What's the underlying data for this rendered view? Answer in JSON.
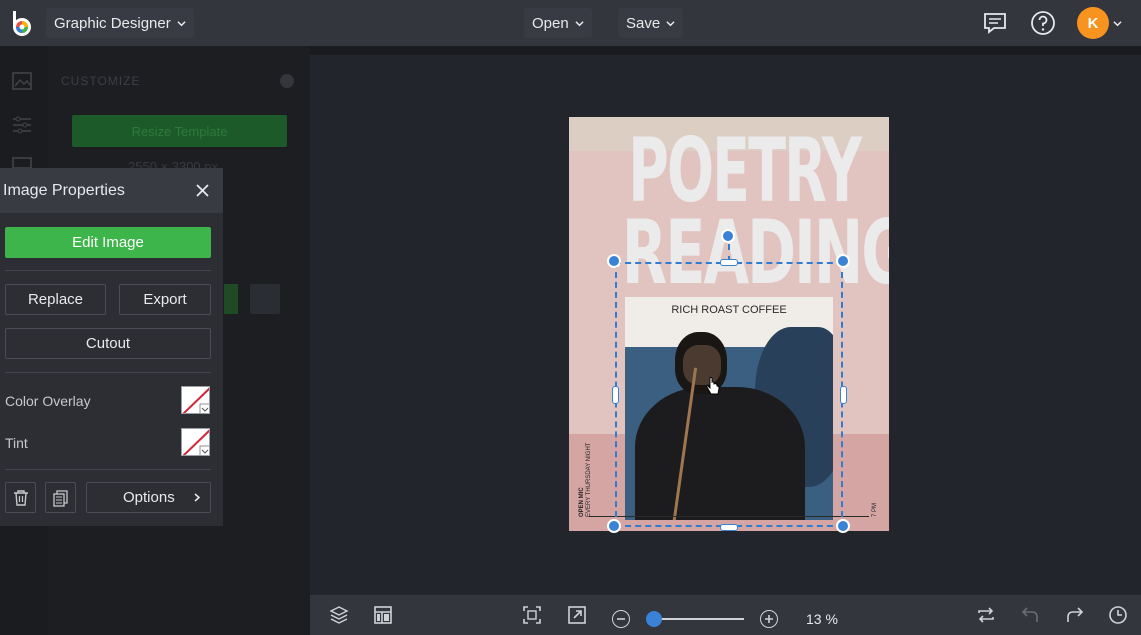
{
  "topbar": {
    "app_name": "Graphic Designer",
    "open_label": "Open",
    "save_label": "Save",
    "avatar_initial": "K"
  },
  "customize": {
    "title": "CUSTOMIZE",
    "resize_label": "Resize Template",
    "dimensions": "2550 × 3300 px"
  },
  "image_properties": {
    "title": "Image Properties",
    "edit_image": "Edit Image",
    "replace": "Replace",
    "export": "Export",
    "cutout": "Cutout",
    "color_overlay": "Color Overlay",
    "tint": "Tint",
    "options": "Options"
  },
  "poster": {
    "title_line1": "POETRY",
    "title_line2": "READING",
    "subtitle": "RICH ROAST COFFEE",
    "side_text_1": "OPEN MIC",
    "side_text_2": "EVERY THURSDAY NIGHT",
    "side_text_3": "7 PM"
  },
  "bottombar": {
    "zoom_percent": "13 %",
    "zoom_value": 0.13
  },
  "colors": {
    "accent_green": "#3db54a",
    "selection_blue": "#3a82d6",
    "avatar_orange": "#f7931e"
  }
}
